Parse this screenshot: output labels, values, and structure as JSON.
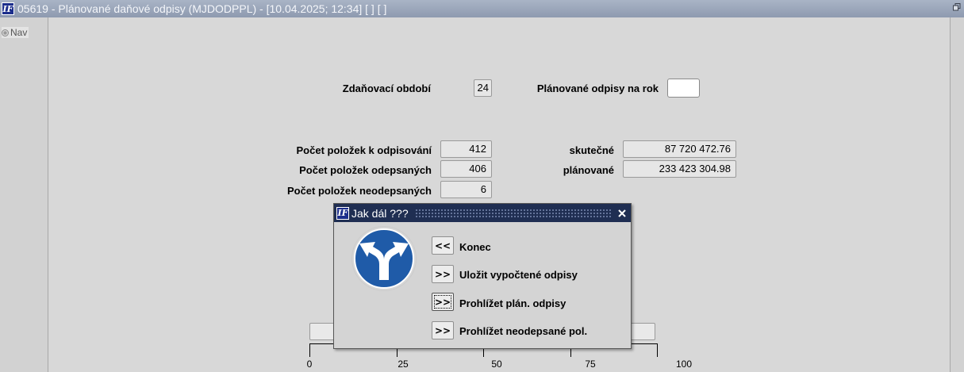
{
  "window": {
    "title": "05619 - Plánované daňové odpisy (MJDODPPL) - [10.04.2025; 12:34]  [ ]  [ ]",
    "logo_text": "IF"
  },
  "nav": {
    "item_label": "Nav"
  },
  "form": {
    "tax_period": {
      "label": "Zdaňovací období",
      "value": "24"
    },
    "planned_year": {
      "label": "Plánované odpisy na rok",
      "value": ""
    },
    "count_to_depreciate": {
      "label": "Počet položek k odpisování",
      "value": "412"
    },
    "count_depreciated": {
      "label": "Počet položek odepsaných",
      "value": "406"
    },
    "count_not_depreciated": {
      "label": "Počet položek neodepsaných",
      "value": "6"
    },
    "actual": {
      "label": "skutečné",
      "value": "87 720 472.76"
    },
    "planned": {
      "label": "plánované",
      "value": "233 423 304.98"
    }
  },
  "progress": {
    "ticks": [
      "0",
      "25",
      "50",
      "75",
      "100"
    ]
  },
  "dialog": {
    "title": "Jak dál ???",
    "buttons": [
      {
        "symbol": "<<",
        "label": "Konec"
      },
      {
        "symbol": ">>",
        "label": "Uložit vypočtené odpisy"
      },
      {
        "symbol": ">>",
        "label": "Prohlížet plán. odpisy"
      },
      {
        "symbol": ">>",
        "label": "Prohlížet neodepsané pol."
      }
    ],
    "icon": "fork-arrow-sign-icon"
  },
  "colors": {
    "titlebar": "#8e9ab0",
    "dialog_title": "#1f2e52",
    "sign_blue": "#1f5ba8"
  }
}
